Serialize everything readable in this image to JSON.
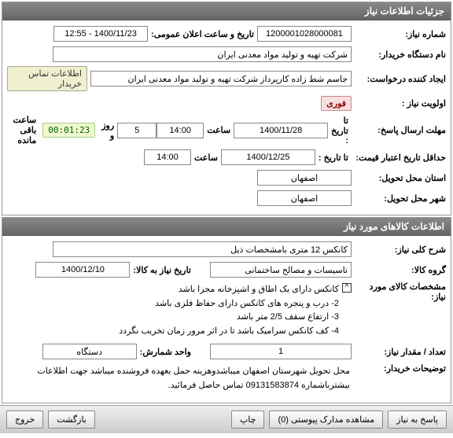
{
  "panel1": {
    "title": "جزئیات اطلاعات نیاز",
    "need_number_label": "شماره نیاز:",
    "need_number": "1200001028000081",
    "announce_label": "تاریخ و ساعت اعلان عمومی:",
    "announce_value": "1400/11/23 - 12:55",
    "buyer_label": "نام دستگاه خریدار:",
    "buyer_value": "شرکت تهیه و تولید مواد معدنی ایران",
    "requester_label": "ایجاد کننده درخواست:",
    "requester_value": "جاسم شط زاده کارپرداز شرکت تهیه و تولید مواد معدنی ایران",
    "contact_badge": "اطلاعات تماس خریدار",
    "priority_label": "اولویت نیاز :",
    "priority_badge": "فوری",
    "deadline_label": "مهلت ارسال پاسخ:",
    "to_date_label": "تا تاریخ :",
    "deadline_date": "1400/11/28",
    "time_label": "ساعت",
    "deadline_time": "14:00",
    "days_value": "5",
    "days_label": "روز و",
    "timer_value": "00:01:23",
    "remaining_label": "ساعت باقی مانده",
    "validity_label": "حداقل تاریخ اعتبار قیمت:",
    "validity_date": "1400/12/25",
    "validity_time": "14:00",
    "province_label": "استان محل تحویل:",
    "province_value": "اصفهان",
    "city_label": "شهر محل تحویل:",
    "city_value": "اصفهان"
  },
  "panel2": {
    "title": "اطلاعات کالاهای مورد نیاز",
    "desc_label": "شرح کلی نیاز:",
    "desc_value": "کانکس 12 متری بامشخصات ذیل",
    "group_label": "گروه کالا:",
    "group_value": "تاسیسات و مصالح ساختمانی",
    "need_date_label": "تاریخ نیاز به کالا:",
    "need_date_value": "1400/12/10",
    "spec_label": "مشخصات کالای مورد نیاز:",
    "spec_lines": [
      "کانکس دارای یک اطاق و اشپزخانه مجزا باشد",
      "2- درب و پنجره های کانکس دارای حفاظ فلزی باشد",
      "3- ارتفاع سقف 2/5 متر باشد",
      "4- کف کانکس سرامیک باشد تا در اثر مرور زمان تخریب نگردد"
    ],
    "qty_label": "تعداد / مقدار نیاز:",
    "qty_value": "1",
    "unit_label": "واحد شمارش:",
    "unit_value": "دستگاه",
    "buyer_note_label": "توضیحات خریدار:",
    "buyer_note_value": "محل تحویل شهرستان اصفهان میباشدوهزینه حمل بعهده فروشنده میباشد جهت اطلاعات بیشترباشماره 09131583874 تماس حاصل فرمائید."
  },
  "footer": {
    "reply_btn": "پاسخ به نیاز",
    "attach_btn": "مشاهده مدارک پیوستی (0)",
    "print_btn": "چاپ",
    "back_btn": "بازگشت",
    "exit_btn": "خروج"
  }
}
